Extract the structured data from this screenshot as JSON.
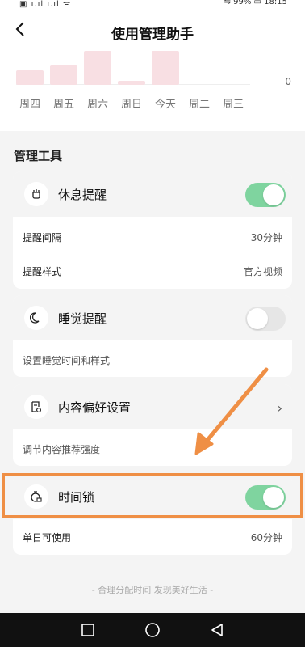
{
  "status_bar": {
    "left_text": "▣ ı.ıl ı.ıl ᯤ",
    "right_text": "⇋ 99% ▭ 18:15"
  },
  "header": {
    "title": "使用管理助手"
  },
  "chart_data": {
    "type": "bar",
    "categories": [
      "周四",
      "周五",
      "周六",
      "周日",
      "今天",
      "周二",
      "周三"
    ],
    "values": [
      18,
      25,
      42,
      5,
      42,
      0,
      0
    ],
    "ylabel_zero": "0",
    "bar_color": "#f8dfe3"
  },
  "section": {
    "title": "管理工具"
  },
  "cards": {
    "rest": {
      "title": "休息提醒",
      "icon": "cup-icon",
      "toggle": true,
      "rows": [
        {
          "label": "提醒间隔",
          "value": "30分钟"
        },
        {
          "label": "提醒样式",
          "value": "官方视频"
        }
      ]
    },
    "sleep": {
      "title": "睡觉提醒",
      "icon": "moon-icon",
      "toggle": false,
      "desc": "设置睡觉时间和样式"
    },
    "pref": {
      "title": "内容偏好设置",
      "icon": "settings-doc-icon",
      "desc": "调节内容推荐强度"
    },
    "lock": {
      "title": "时间锁",
      "icon": "lock-icon",
      "toggle": true,
      "rows": [
        {
          "label": "单日可使用",
          "value": "60分钟"
        }
      ]
    }
  },
  "footer": {
    "text": "- 合理分配时间 发现美好生活 -"
  },
  "colors": {
    "toggle_on": "#7fd49f",
    "toggle_off": "#e6e6e6",
    "highlight": "#ef8f45",
    "arrow": "#ef8f45"
  }
}
